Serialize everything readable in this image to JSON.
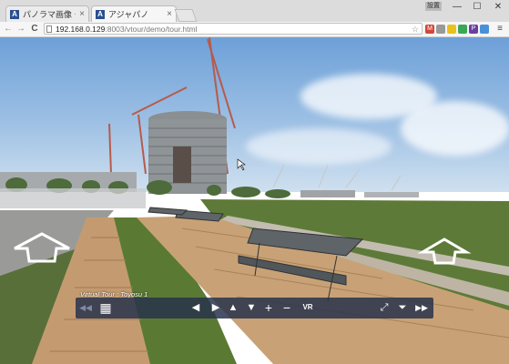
{
  "browser": {
    "tabs": [
      {
        "favicon": "A",
        "title": "パノラマ画像・パノラマ動画…",
        "close": "×"
      },
      {
        "favicon": "A",
        "title": "アジャパノ",
        "close": "×"
      }
    ],
    "profile_label": "設置",
    "window_buttons": [
      "—",
      "☐",
      "✕"
    ],
    "back": "←",
    "forward": "→",
    "reload": "C",
    "url_host": "192.168.0.129",
    "url_path": ":8003/vtour/demo/tour.html",
    "star": "☆",
    "extensions": [
      {
        "name": "gmail-icon",
        "color": "#d44638",
        "glyph": "M"
      },
      {
        "name": "extension-icon",
        "color": "#999999",
        "glyph": ""
      },
      {
        "name": "tag-icon",
        "color": "#e8c21b",
        "glyph": ""
      },
      {
        "name": "extension-green-icon",
        "color": "#3aa757",
        "glyph": ""
      },
      {
        "name": "purple-extension-icon",
        "color": "#6b3fa0",
        "glyph": "P"
      },
      {
        "name": "cast-icon",
        "color": "#4a90d9",
        "glyph": ""
      }
    ],
    "menu": "≡"
  },
  "tour": {
    "label": "Virtual Tour : Toyosu 1",
    "controls": {
      "prev_scene": "◀◀",
      "thumbs": "▦",
      "left": "◀",
      "right": "▶",
      "up": "▲",
      "down": "▼",
      "zoom_in": "+",
      "zoom_out": "−",
      "vr": "VR",
      "fullscreen": "⤢",
      "hide": "⏷",
      "next_scene": "▶▶"
    }
  }
}
